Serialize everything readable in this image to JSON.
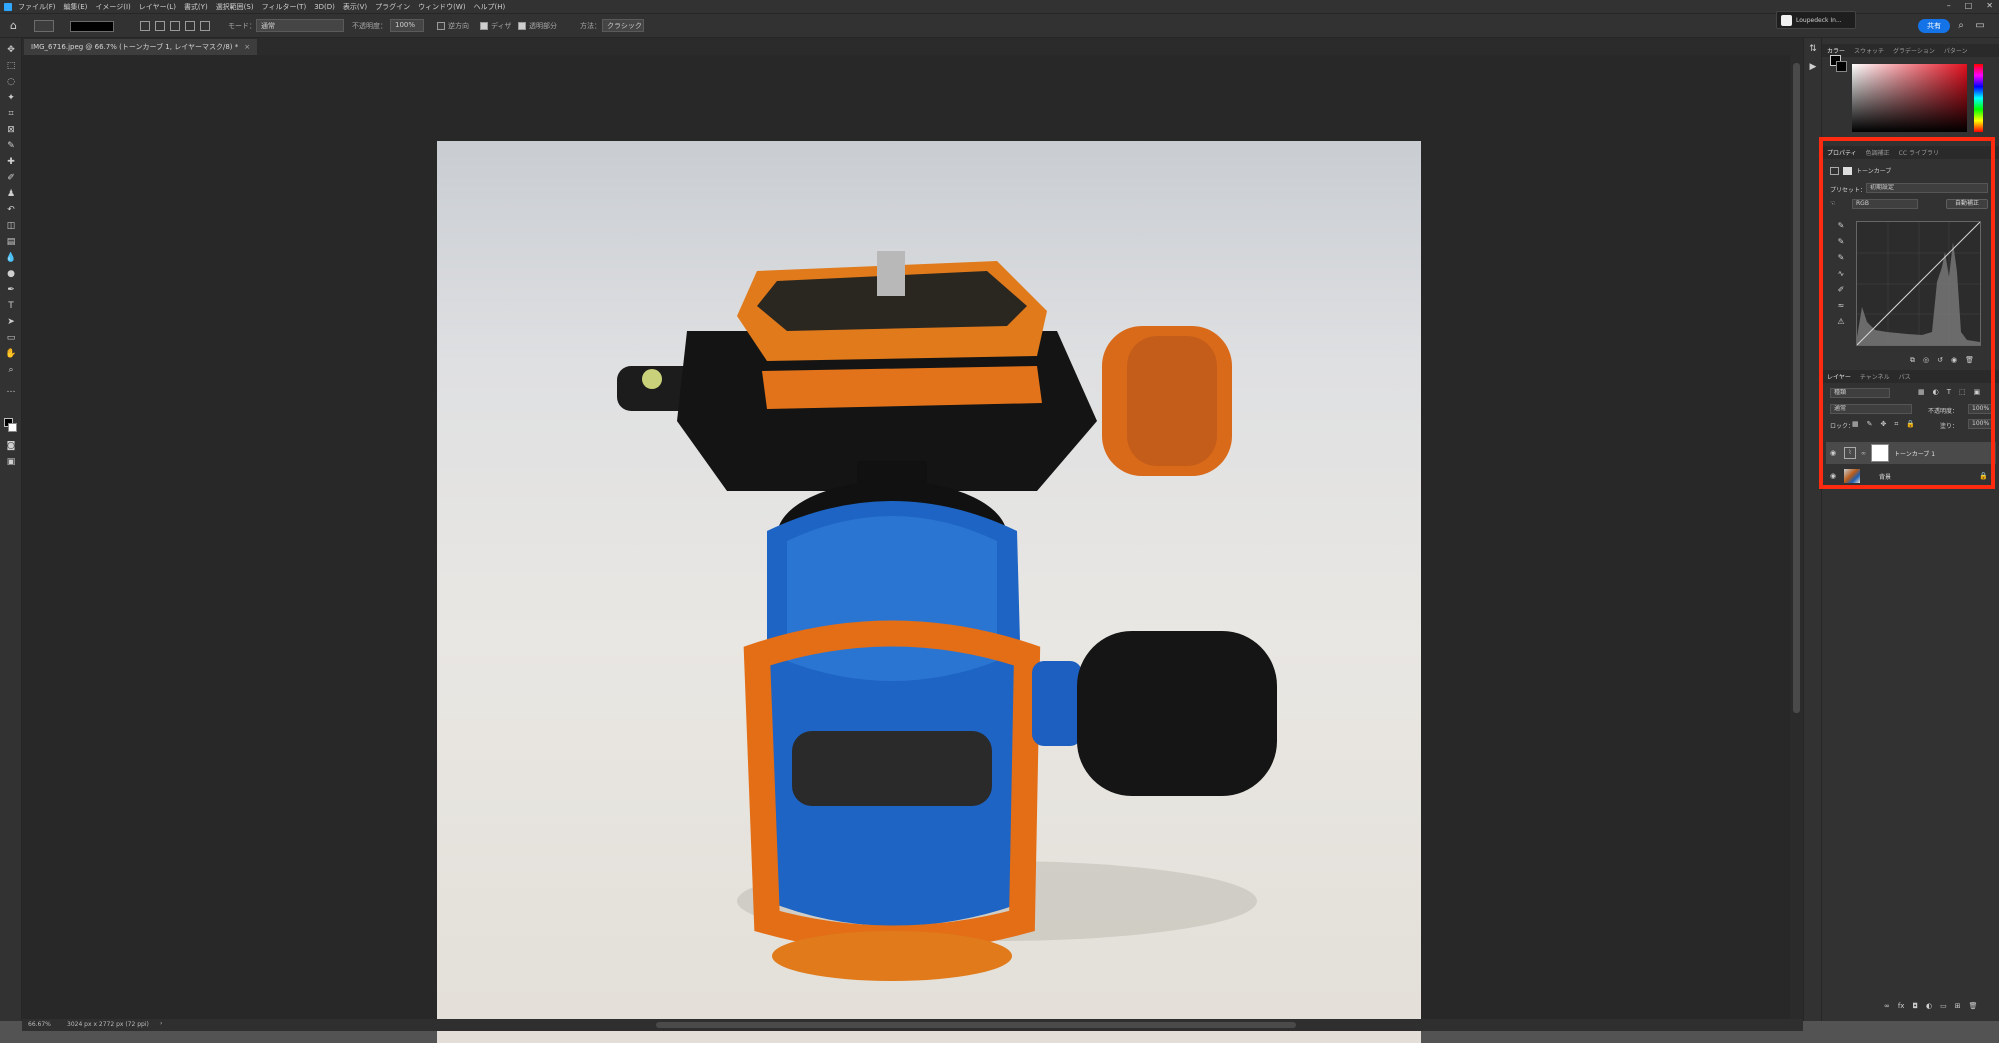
{
  "menu": [
    "ファイル(F)",
    "編集(E)",
    "イメージ(I)",
    "レイヤー(L)",
    "書式(Y)",
    "選択範囲(S)",
    "フィルター(T)",
    "3D(D)",
    "表示(V)",
    "プラグイン",
    "ウィンドウ(W)",
    "ヘルプ(H)"
  ],
  "window_controls": [
    "–",
    "□",
    "✕"
  ],
  "options": {
    "mode_label": "モード：",
    "mode_value": "通常",
    "opacity_label": "不透明度：",
    "opacity_value": "100%",
    "reverse_label": "逆方向",
    "dither_label": "ディザ",
    "transparency_label": "透明部分",
    "method_label": "方法：",
    "method_value": "クラシック",
    "share_label": "共有"
  },
  "cloud_chip": {
    "title": "Loupedeck In..."
  },
  "document": {
    "tab_title": "IMG_6716.jpeg @ 66.7% (トーンカーブ 1, レイヤーマスク/8) *",
    "tab_close": "×",
    "zoom": "66.67%",
    "size": "3024 px x 2772 px (72 ppi)",
    "nav_arrow": "›"
  },
  "color_panel": {
    "tabs": [
      "カラー",
      "スウォッチ",
      "グラデーション",
      "パターン"
    ],
    "active": 0
  },
  "properties_panel": {
    "tabs": [
      "プロパティ",
      "色調補正",
      "CC ライブラリ"
    ],
    "active": 0,
    "adjustment_name": "トーンカーブ",
    "preset_label": "プリセット：",
    "preset_value": "初期設定",
    "channel_value": "RGB",
    "auto_label": "自動補正"
  },
  "layers_panel": {
    "tabs": [
      "レイヤー",
      "チャンネル",
      "パス"
    ],
    "active": 0,
    "filter_value": "種類",
    "blend_value": "通常",
    "opacity_label": "不透明度：",
    "opacity_value": "100%",
    "lock_label": "ロック：",
    "fill_label": "塗り：",
    "fill_value": "100%",
    "layers": [
      {
        "name": "トーンカーブ 1",
        "selected": true
      },
      {
        "name": "背景",
        "selected": false
      }
    ]
  },
  "colors": {
    "highlight": "#ff2b11",
    "share": "#1473e6"
  }
}
